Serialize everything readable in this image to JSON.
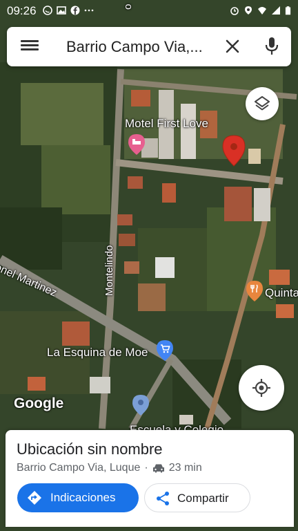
{
  "status_bar": {
    "time": "09:26"
  },
  "search": {
    "query": "Barrio Campo Via,..."
  },
  "map": {
    "labels": {
      "motel": "Motel First Love",
      "montelindo_top": "o",
      "montelindo": "Montelindo",
      "coronel": "onel Martinez",
      "quinta": "Quinta",
      "esquina": "La Esquina de Moe",
      "escuela": "Escuela y Colegio"
    },
    "google": "Google"
  },
  "card": {
    "title": "Ubicación sin nombre",
    "address": "Barrio Campo Via, Luque",
    "separator": "·",
    "drive_time": "23 min",
    "directions_label": "Indicaciones",
    "share_label": "Compartir"
  },
  "colors": {
    "accent": "#1a73e8",
    "pin": "#d93025"
  }
}
